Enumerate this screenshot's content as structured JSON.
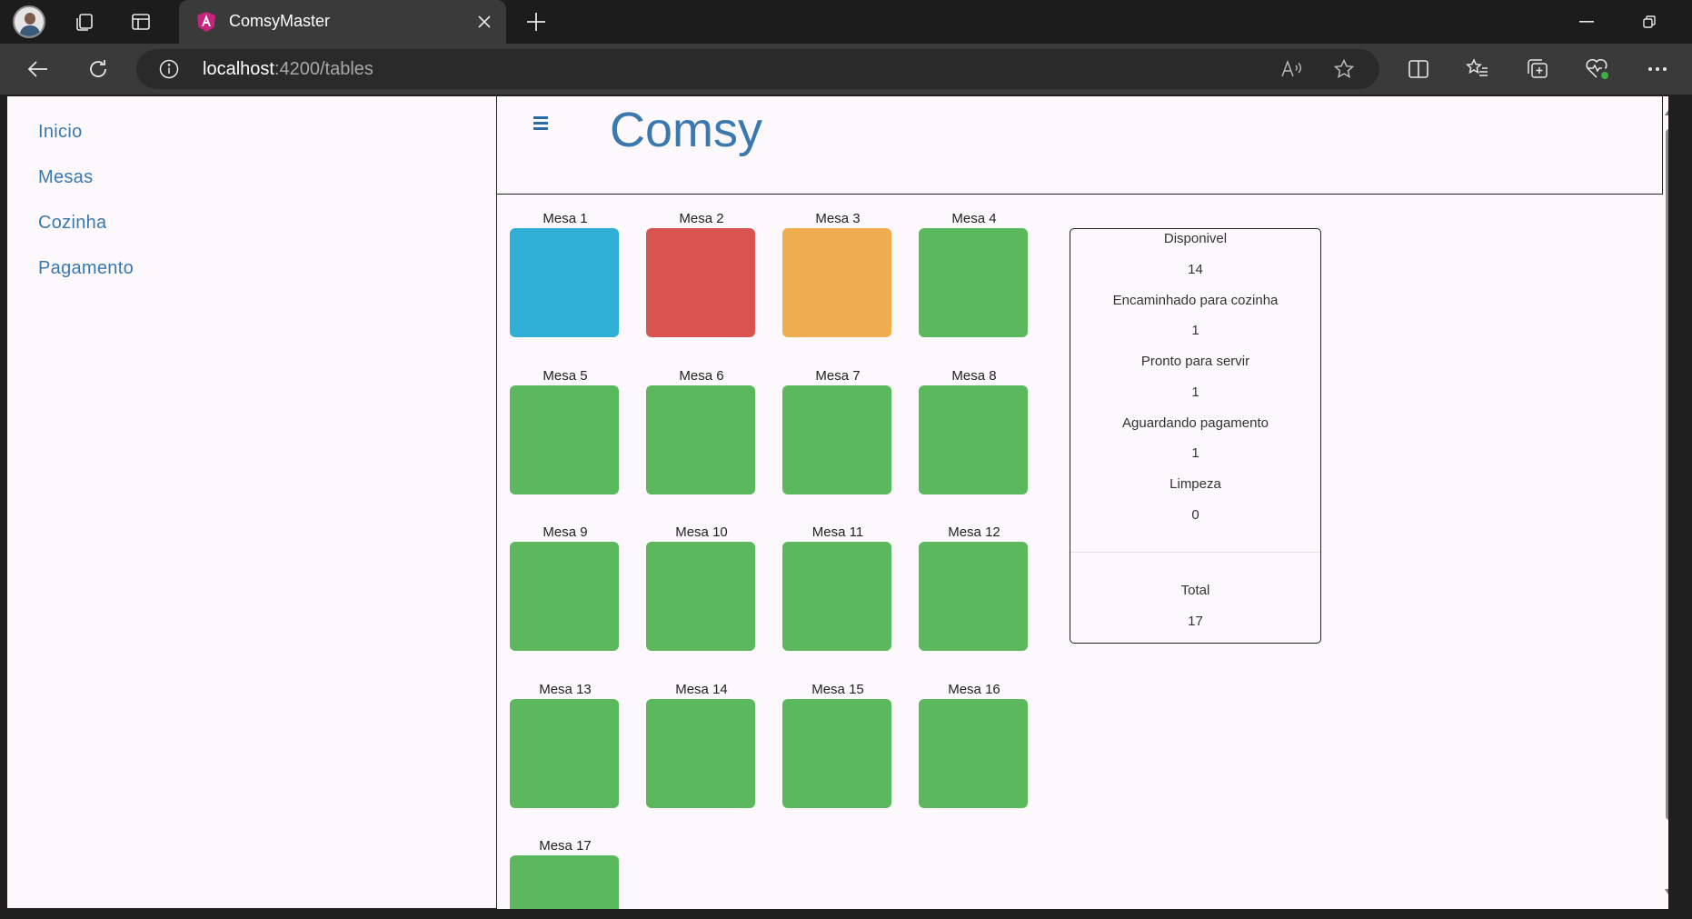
{
  "browser": {
    "tab_title": "ComsyMaster",
    "address_host": "localhost",
    "address_path": ":4200/tables"
  },
  "sidebar": {
    "items": [
      {
        "label": "Inicio"
      },
      {
        "label": "Mesas"
      },
      {
        "label": "Cozinha"
      },
      {
        "label": "Pagamento"
      }
    ]
  },
  "header": {
    "title": "Comsy"
  },
  "colors": {
    "disponivel": "#5cb85c",
    "encaminhado": "#d9534f",
    "pronto": "#2faed6",
    "aguardando": "#f0ad4e",
    "accent": "#3a78b0"
  },
  "tables": [
    {
      "label": "Mesa 1",
      "status": "pronto"
    },
    {
      "label": "Mesa 2",
      "status": "encaminhado"
    },
    {
      "label": "Mesa 3",
      "status": "aguardando"
    },
    {
      "label": "Mesa 4",
      "status": "disponivel"
    },
    {
      "label": "Mesa 5",
      "status": "disponivel"
    },
    {
      "label": "Mesa 6",
      "status": "disponivel"
    },
    {
      "label": "Mesa 7",
      "status": "disponivel"
    },
    {
      "label": "Mesa 8",
      "status": "disponivel"
    },
    {
      "label": "Mesa 9",
      "status": "disponivel"
    },
    {
      "label": "Mesa 10",
      "status": "disponivel"
    },
    {
      "label": "Mesa 11",
      "status": "disponivel"
    },
    {
      "label": "Mesa 12",
      "status": "disponivel"
    },
    {
      "label": "Mesa 13",
      "status": "disponivel"
    },
    {
      "label": "Mesa 14",
      "status": "disponivel"
    },
    {
      "label": "Mesa 15",
      "status": "disponivel"
    },
    {
      "label": "Mesa 16",
      "status": "disponivel"
    },
    {
      "label": "Mesa 17",
      "status": "disponivel"
    }
  ],
  "summary": {
    "disponivel_label": "Disponivel",
    "disponivel_value": "14",
    "encaminhado_label": "Encaminhado para cozinha",
    "encaminhado_value": "1",
    "pronto_label": "Pronto para servir",
    "pronto_value": "1",
    "aguardando_label": "Aguardando pagamento",
    "aguardando_value": "1",
    "limpeza_label": "Limpeza",
    "limpeza_value": "0",
    "total_label": "Total",
    "total_value": "17"
  }
}
